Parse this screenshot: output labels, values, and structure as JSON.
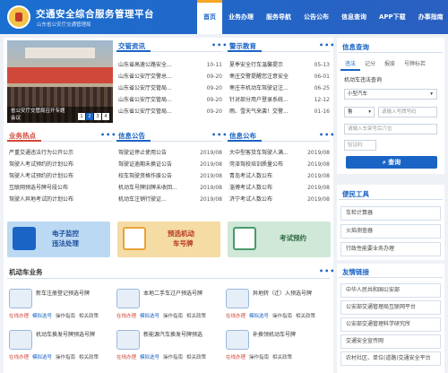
{
  "header": {
    "title": "交通安全综合服务管理平台",
    "subtitle": "山东省公安厅交通管理局",
    "nav": [
      "首页",
      "业务办理",
      "服务导航",
      "公告公布",
      "信息查询",
      "APP下载",
      "办事指南"
    ],
    "active_nav": "首页"
  },
  "banner": {
    "caption": "省公安厅交管局召开专题",
    "caption2": "会议",
    "pages": [
      "1",
      "2",
      "3",
      "4"
    ],
    "active_page": "2"
  },
  "news": {
    "title": "交管资讯",
    "more": "•••",
    "items": [
      {
        "text": "山东省高速公路安全...",
        "date": "10-11"
      },
      {
        "text": "山东省公安厅交警总...",
        "date": "09-20"
      },
      {
        "text": "山东省公安厅交管局...",
        "date": "09-20"
      },
      {
        "text": "山东省公安厅交管局...",
        "date": "09-20"
      },
      {
        "text": "山东省公安厅交管局...",
        "date": "09-20"
      }
    ]
  },
  "warning": {
    "title": "警示教育",
    "more": "•••",
    "items": [
      {
        "text": "夏季安全行车温馨提示",
        "date": "05-13"
      },
      {
        "text": "枣庄交警提醒您注意安全",
        "date": "06-01"
      },
      {
        "text": "枣庄市机动车驾驶证注...",
        "date": "06-25"
      },
      {
        "text": "针对部分用户登录系统...",
        "date": "12-12"
      },
      {
        "text": "雨、雪天气来袭！交警...",
        "date": "01-16"
      }
    ]
  },
  "hot": {
    "title": "业务热点",
    "more": "•••",
    "items": [
      "严重交通违法行为公开公示",
      "驾驶人考试预约的计划公布",
      "驾驶人考试预约的计划公布",
      "互联网预选号牌号段公布",
      "驾驶人异地考试的计划公布"
    ]
  },
  "notice": {
    "title": "信息公告",
    "more": "•••",
    "items": [
      {
        "text": "驾驶证停止使用公告",
        "date": "2019/08"
      },
      {
        "text": "驾驶证逾期未换证公告",
        "date": "2019/08"
      },
      {
        "text": "校车驾驶资格作废公告",
        "date": "2019/08"
      },
      {
        "text": "机动车号牌旧牌未收回...",
        "date": "2019/08"
      },
      {
        "text": "机动车注销行驶证...",
        "date": "2019/08"
      }
    ]
  },
  "bulletin": {
    "title": "信息公布",
    "more": "•••",
    "items": [
      {
        "text": "大中型客货车驾驶人满...",
        "date": "2019/08"
      },
      {
        "text": "菏泽驾校培训质量公布",
        "date": "2019/08"
      },
      {
        "text": "青岛考试人数公布",
        "date": "2019/08"
      },
      {
        "text": "淄博考试人数公布",
        "date": "2019/08"
      },
      {
        "text": "济宁考试人数公布",
        "date": "2019/08"
      }
    ]
  },
  "services": [
    {
      "line1": "电子监控",
      "line2": "违法处理"
    },
    {
      "line1": "预选机动",
      "line2": "车号牌"
    },
    {
      "line1": "考试预约",
      "line2": ""
    }
  ],
  "vehicle_biz": {
    "title": "机动车业务",
    "more": "•••",
    "items": [
      {
        "name": "新车注册登记预选号牌"
      },
      {
        "name": "本地二手车过户预选号牌"
      },
      {
        "name": "异地转（迁）入预选号牌"
      },
      {
        "name": "机动车换发号牌预选号牌"
      },
      {
        "name": "新能源汽车换发号牌预选"
      },
      {
        "name": "补换领机动车号牌"
      }
    ],
    "links": [
      "在线办理",
      "模拟选号",
      "操作指南",
      "相关政策"
    ]
  },
  "query": {
    "title": "信息查询",
    "tabs": [
      "违法",
      "记分",
      "报废",
      "号牌标若"
    ],
    "active_tab": "违法",
    "section_label": "机动车违法查询",
    "vehicle_type": "小型汽车",
    "province": "鲁",
    "plate_placeholder": "请输入号牌号码",
    "vin_placeholder": "请输入车架号后六位",
    "captcha_placeholder": "验证码",
    "button": "查询"
  },
  "tools": {
    "title": "便民工具",
    "items": [
      "车检计算器",
      "火焰测查器",
      "行政性能要业务办理"
    ]
  },
  "links": {
    "title": "友情链接",
    "items": [
      "中华人民共和国公安部",
      "公安部交通管理局互联网平台",
      "公安部交通管理科学研究所",
      "交通安全宣传网",
      "农村社区、单位(道路)交通安全平台"
    ]
  }
}
